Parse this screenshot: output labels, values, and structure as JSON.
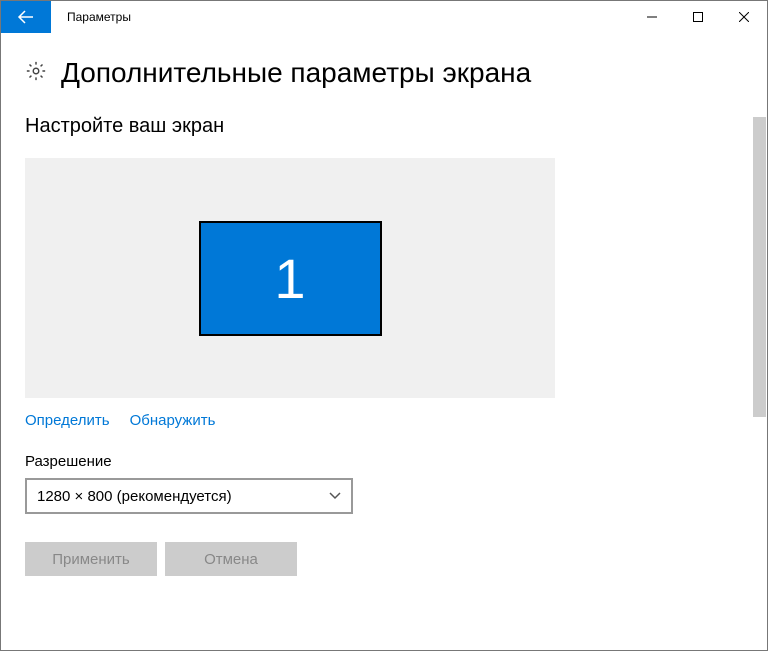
{
  "titlebar": {
    "title": "Параметры"
  },
  "page": {
    "heading": "Дополнительные параметры экрана",
    "section_heading": "Настройте ваш экран"
  },
  "display": {
    "monitor_number": "1"
  },
  "links": {
    "identify": "Определить",
    "detect": "Обнаружить"
  },
  "resolution": {
    "label": "Разрешение",
    "selected": "1280 × 800 (рекомендуется)"
  },
  "buttons": {
    "apply": "Применить",
    "cancel": "Отмена"
  }
}
